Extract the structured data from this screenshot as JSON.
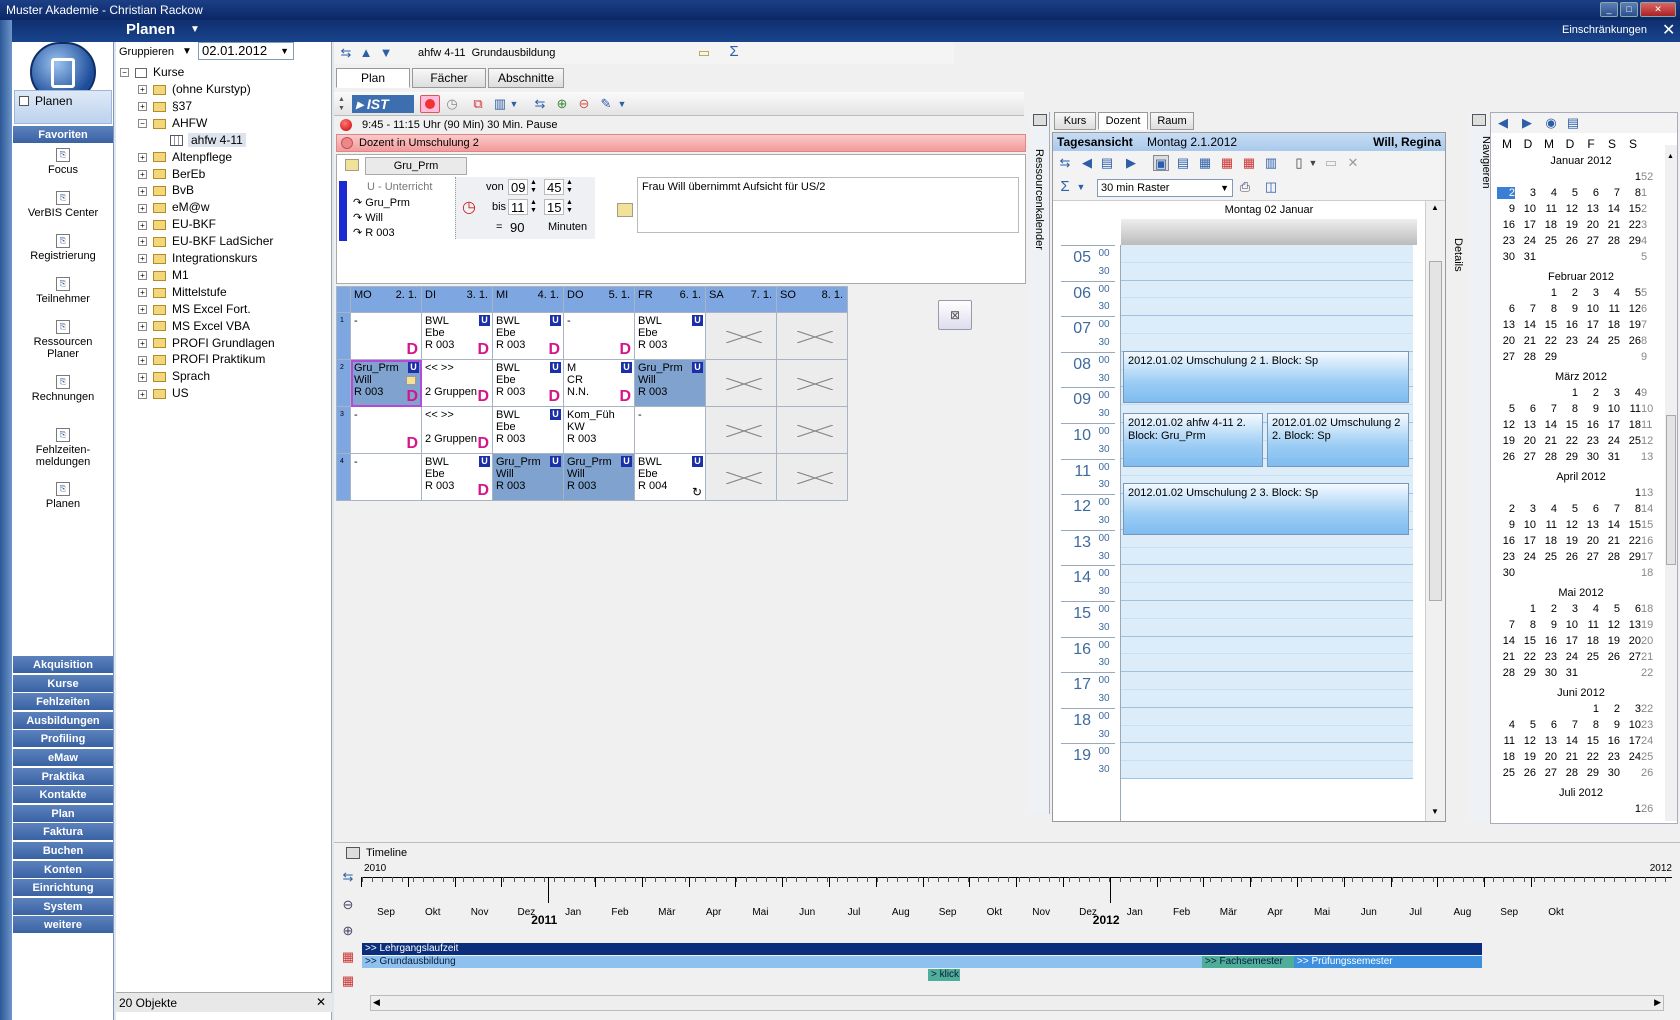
{
  "window": {
    "title": "Muster Akademie - Christian Rackow"
  },
  "header": {
    "section": "Planen",
    "restrictions": "Einschränkungen"
  },
  "leftnav": {
    "current": "Planen",
    "favorites_title": "Favoriten",
    "favorites": [
      "Focus",
      "VerBIS Center",
      "Registrierung",
      "Teilnehmer",
      "Ressourcen Planer",
      "Rechnungen",
      "Fehlzeiten-meldungen",
      "Planen"
    ],
    "modules": [
      "Akquisition",
      "Kurse",
      "Fehlzeiten",
      "Ausbildungen",
      "Profiling",
      "eMaw",
      "Praktika",
      "Kontakte",
      "Plan",
      "Faktura",
      "Buchen",
      "Konten",
      "Einrichtung",
      "System",
      "weitere"
    ]
  },
  "tree": {
    "group_label": "Gruppieren",
    "date": "02.01.2012",
    "root": "Kurse",
    "items": [
      "(ohne Kurstyp)",
      "§37",
      "AHFW",
      "ahfw 4-11",
      "Altenpflege",
      "BerEb",
      "BvB",
      "eM@w",
      "EU-BKF",
      "EU-BKF LadSicher",
      "Integrationskurs",
      "M1",
      "Mittelstufe",
      "MS Excel Fort.",
      "MS Excel VBA",
      "PROFI Grundlagen",
      "PROFI Praktikum",
      "Sprach",
      "US"
    ],
    "footer": "20 Objekte"
  },
  "plan": {
    "course_title": "ahfw 4-11  Grundausbildung",
    "tabs": [
      "Plan",
      "Fächer",
      "Abschnitte"
    ],
    "mode": "IST",
    "time_info": "9:45 - 11:15 Uhr (90 Min) 30 Min. Pause",
    "alert": "Dozent in Umschulung 2",
    "subtab": "Gru_Prm",
    "type": "U - Unterricht",
    "subject": "Gru_Prm",
    "teacher": "Will",
    "room": "R 003",
    "von_label": "von",
    "von_h": "09",
    "von_m": "45",
    "bis_label": "bis",
    "bis_h": "11",
    "bis_m": "15",
    "eq": "=",
    "duration": "90",
    "minutes_label": "Minuten",
    "note": "Frau Will übernimmt Aufsicht für US/2",
    "days": [
      {
        "d": "MO",
        "n": "2. 1."
      },
      {
        "d": "DI",
        "n": "3. 1."
      },
      {
        "d": "MI",
        "n": "4. 1."
      },
      {
        "d": "DO",
        "n": "5. 1."
      },
      {
        "d": "FR",
        "n": "6. 1."
      },
      {
        "d": "SA",
        "n": "7. 1."
      },
      {
        "d": "SO",
        "n": "8. 1."
      }
    ],
    "rows": [
      {
        "n": "1",
        "cells": [
          {
            "lines": [
              "-"
            ],
            "d": true,
            "u": false,
            "bg": "white"
          },
          {
            "lines": [
              "BWL",
              "Ebe",
              "R 003"
            ],
            "d": true,
            "u": true,
            "bg": "white"
          },
          {
            "lines": [
              "BWL",
              "Ebe",
              "R 003"
            ],
            "d": true,
            "u": true,
            "bg": "white"
          },
          {
            "lines": [
              "-"
            ],
            "d": true,
            "u": false,
            "bg": "white"
          },
          {
            "lines": [
              "BWL",
              "Ebe",
              "R 003"
            ],
            "d": false,
            "u": true,
            "bg": "white"
          },
          {
            "lines": [],
            "x": true,
            "bg": "gray"
          },
          {
            "lines": [],
            "x": true,
            "bg": "gray"
          }
        ]
      },
      {
        "n": "2",
        "cells": [
          {
            "lines": [
              "Gru_Prm",
              "Will",
              "R 003"
            ],
            "d": true,
            "u": true,
            "bg": "blue",
            "sel": true
          },
          {
            "lines": [
              "<< >>",
              "",
              "2 Gruppen"
            ],
            "d": true,
            "u": false,
            "bg": "white"
          },
          {
            "lines": [
              "BWL",
              "Ebe",
              "R 003"
            ],
            "d": true,
            "u": true,
            "bg": "white"
          },
          {
            "lines": [
              "M",
              "CR",
              "N.N."
            ],
            "d": true,
            "u": true,
            "bg": "white"
          },
          {
            "lines": [
              "Gru_Prm",
              "Will",
              "R 003"
            ],
            "d": false,
            "u": true,
            "bg": "blue"
          },
          {
            "lines": [],
            "x": true,
            "bg": "gray"
          },
          {
            "lines": [],
            "x": true,
            "bg": "gray"
          }
        ]
      },
      {
        "n": "3",
        "cells": [
          {
            "lines": [
              "-"
            ],
            "d": true,
            "u": false,
            "bg": "white"
          },
          {
            "lines": [
              "<< >>",
              "",
              "2 Gruppen"
            ],
            "d": true,
            "u": false,
            "bg": "white"
          },
          {
            "lines": [
              "BWL",
              "Ebe",
              "R 003"
            ],
            "d": false,
            "u": true,
            "bg": "white"
          },
          {
            "lines": [
              "Kom_Füh",
              "KW",
              "R 003"
            ],
            "d": false,
            "u": false,
            "bg": "white"
          },
          {
            "lines": [
              "-"
            ],
            "d": false,
            "u": false,
            "bg": "white"
          },
          {
            "lines": [],
            "x": true,
            "bg": "gray"
          },
          {
            "lines": [],
            "x": true,
            "bg": "gray"
          }
        ]
      },
      {
        "n": "4",
        "cells": [
          {
            "lines": [
              "-"
            ],
            "d": false,
            "u": false,
            "bg": "white"
          },
          {
            "lines": [
              "BWL",
              "Ebe",
              "R 003"
            ],
            "d": true,
            "u": true,
            "bg": "white"
          },
          {
            "lines": [
              "Gru_Prm",
              "Will",
              "R 003"
            ],
            "d": false,
            "u": true,
            "bg": "blue"
          },
          {
            "lines": [
              "Gru_Prm",
              "Will",
              "R 003"
            ],
            "d": false,
            "u": true,
            "bg": "blue"
          },
          {
            "lines": [
              "BWL",
              "Ebe",
              "R 004"
            ],
            "d": false,
            "u": true,
            "bg": "white"
          },
          {
            "lines": [],
            "x": true,
            "bg": "gray"
          },
          {
            "lines": [],
            "x": true,
            "bg": "gray"
          }
        ]
      }
    ]
  },
  "resource": {
    "side_label": "Ressourcenkalender",
    "tabs": [
      "Kurs",
      "Dozent",
      "Raum"
    ],
    "view_title": "Tagesansicht",
    "view_date": "Montag 2.1.2012",
    "person": "Will, Regina",
    "raster": "30 min Raster",
    "day_header": "Montag 02 Januar",
    "details": "Details",
    "hours": [
      "05",
      "06",
      "07",
      "08",
      "09",
      "10",
      "11",
      "12",
      "13",
      "14",
      "15",
      "16",
      "17",
      "18",
      "19"
    ],
    "minutes": [
      "00",
      "30"
    ],
    "appointments": [
      "2012.01.02 Umschulung 2 1. Block: Sp",
      "2012.01.02 ahfw 4-11 2. Block: Gru_Prm",
      "2012.01.02 Umschulung 2 2. Block: Sp",
      "2012.01.02 Umschulung 2 3. Block: Sp"
    ]
  },
  "navigator": {
    "label": "Navigieren",
    "weekdays": [
      "M",
      "D",
      "M",
      "D",
      "F",
      "S",
      "S"
    ],
    "months": [
      {
        "name": "Januar 2012",
        "rows": [
          [
            "",
            "",
            "",
            "",
            "",
            "",
            "1",
            "52"
          ],
          [
            "2",
            "3",
            "4",
            "5",
            "6",
            "7",
            "8",
            "1"
          ],
          [
            "9",
            "10",
            "11",
            "12",
            "13",
            "14",
            "15",
            "2"
          ],
          [
            "16",
            "17",
            "18",
            "19",
            "20",
            "21",
            "22",
            "3"
          ],
          [
            "23",
            "24",
            "25",
            "26",
            "27",
            "28",
            "29",
            "4"
          ],
          [
            "30",
            "31",
            "",
            "",
            "",
            "",
            "",
            "5"
          ]
        ]
      },
      {
        "name": "Februar 2012",
        "rows": [
          [
            "",
            "",
            "1",
            "2",
            "3",
            "4",
            "5",
            "5"
          ],
          [
            "6",
            "7",
            "8",
            "9",
            "10",
            "11",
            "12",
            "6"
          ],
          [
            "13",
            "14",
            "15",
            "16",
            "17",
            "18",
            "19",
            "7"
          ],
          [
            "20",
            "21",
            "22",
            "23",
            "24",
            "25",
            "26",
            "8"
          ],
          [
            "27",
            "28",
            "29",
            "",
            "",
            "",
            "",
            "9"
          ]
        ]
      },
      {
        "name": "März 2012",
        "rows": [
          [
            "",
            "",
            "",
            "1",
            "2",
            "3",
            "4",
            "9"
          ],
          [
            "5",
            "6",
            "7",
            "8",
            "9",
            "10",
            "11",
            "10"
          ],
          [
            "12",
            "13",
            "14",
            "15",
            "16",
            "17",
            "18",
            "11"
          ],
          [
            "19",
            "20",
            "21",
            "22",
            "23",
            "24",
            "25",
            "12"
          ],
          [
            "26",
            "27",
            "28",
            "29",
            "30",
            "31",
            "",
            "13"
          ]
        ]
      },
      {
        "name": "April 2012",
        "rows": [
          [
            "",
            "",
            "",
            "",
            "",
            "",
            "1",
            "13"
          ],
          [
            "2",
            "3",
            "4",
            "5",
            "6",
            "7",
            "8",
            "14"
          ],
          [
            "9",
            "10",
            "11",
            "12",
            "13",
            "14",
            "15",
            "15"
          ],
          [
            "16",
            "17",
            "18",
            "19",
            "20",
            "21",
            "22",
            "16"
          ],
          [
            "23",
            "24",
            "25",
            "26",
            "27",
            "28",
            "29",
            "17"
          ],
          [
            "30",
            "",
            "",
            "",
            "",
            "",
            "",
            "18"
          ]
        ]
      },
      {
        "name": "Mai 2012",
        "rows": [
          [
            "",
            "1",
            "2",
            "3",
            "4",
            "5",
            "6",
            "18"
          ],
          [
            "7",
            "8",
            "9",
            "10",
            "11",
            "12",
            "13",
            "19"
          ],
          [
            "14",
            "15",
            "16",
            "17",
            "18",
            "19",
            "20",
            "20"
          ],
          [
            "21",
            "22",
            "23",
            "24",
            "25",
            "26",
            "27",
            "21"
          ],
          [
            "28",
            "29",
            "30",
            "31",
            "",
            "",
            "",
            "22"
          ]
        ]
      },
      {
        "name": "Juni 2012",
        "rows": [
          [
            "",
            "",
            "",
            "",
            "1",
            "2",
            "3",
            "22"
          ],
          [
            "4",
            "5",
            "6",
            "7",
            "8",
            "9",
            "10",
            "23"
          ],
          [
            "11",
            "12",
            "13",
            "14",
            "15",
            "16",
            "17",
            "24"
          ],
          [
            "18",
            "19",
            "20",
            "21",
            "22",
            "23",
            "24",
            "25"
          ],
          [
            "25",
            "26",
            "27",
            "28",
            "29",
            "30",
            "",
            "26"
          ]
        ]
      },
      {
        "name": "Juli 2012",
        "rows": [
          [
            "",
            "",
            "",
            "",
            "",
            "",
            "1",
            "26"
          ]
        ]
      }
    ]
  },
  "timeline": {
    "title": "Timeline",
    "year_left": "2010",
    "year_right": "2012",
    "year_2011": "2011",
    "year_2012": "2012",
    "months": [
      "Sep",
      "Okt",
      "Nov",
      "Dez",
      "Jan",
      "Feb",
      "Mär",
      "Apr",
      "Mai",
      "Jun",
      "Jul",
      "Aug",
      "Sep",
      "Okt",
      "Nov",
      "Dez",
      "Jan",
      "Feb",
      "Mär",
      "Apr",
      "Mai",
      "Jun",
      "Jul",
      "Aug",
      "Sep",
      "Okt"
    ],
    "bars": [
      {
        "label": ">> Lehrgangslaufzeit",
        "color": "#0a2e7c"
      },
      {
        "label": ">> Grundausbildung",
        "color": "#8fc1ef"
      },
      {
        "label": ">> Fachsemester",
        "color": "#4fae9a"
      },
      {
        "label": ">> Prüfungssemester",
        "color": "#3d8fe0"
      },
      {
        "label": "> klick",
        "color": "#4fae9a"
      }
    ]
  }
}
